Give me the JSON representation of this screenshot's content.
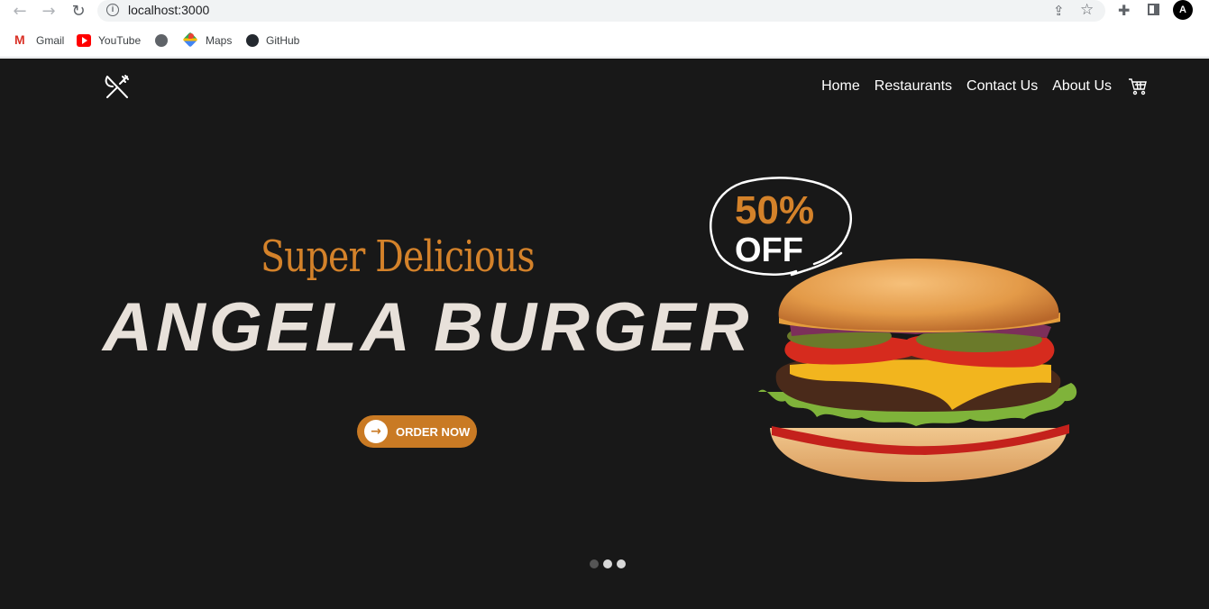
{
  "browser": {
    "url": "localhost:3000",
    "bookmarks": [
      {
        "label": "Gmail",
        "icon": "gmail-icon"
      },
      {
        "label": "YouTube",
        "icon": "youtube-icon"
      },
      {
        "label": "",
        "icon": "globe-icon"
      },
      {
        "label": "Maps",
        "icon": "maps-icon"
      },
      {
        "label": "GitHub",
        "icon": "github-icon"
      }
    ]
  },
  "site": {
    "nav": {
      "items": [
        "Home",
        "Restaurants",
        "Contact Us",
        "About Us"
      ],
      "cart_icon": "cart-icon",
      "logo_icon": "fork-knife-icon"
    },
    "hero": {
      "subtitle": "Super Delicious",
      "title": "ANGELA BURGER",
      "order_button": "ORDER NOW",
      "badge_percent": "50%",
      "badge_text": "OFF",
      "accent_color": "#d4822a",
      "background_color": "#181818"
    },
    "carousel": {
      "slide_count": 3,
      "active_index": 0
    }
  }
}
